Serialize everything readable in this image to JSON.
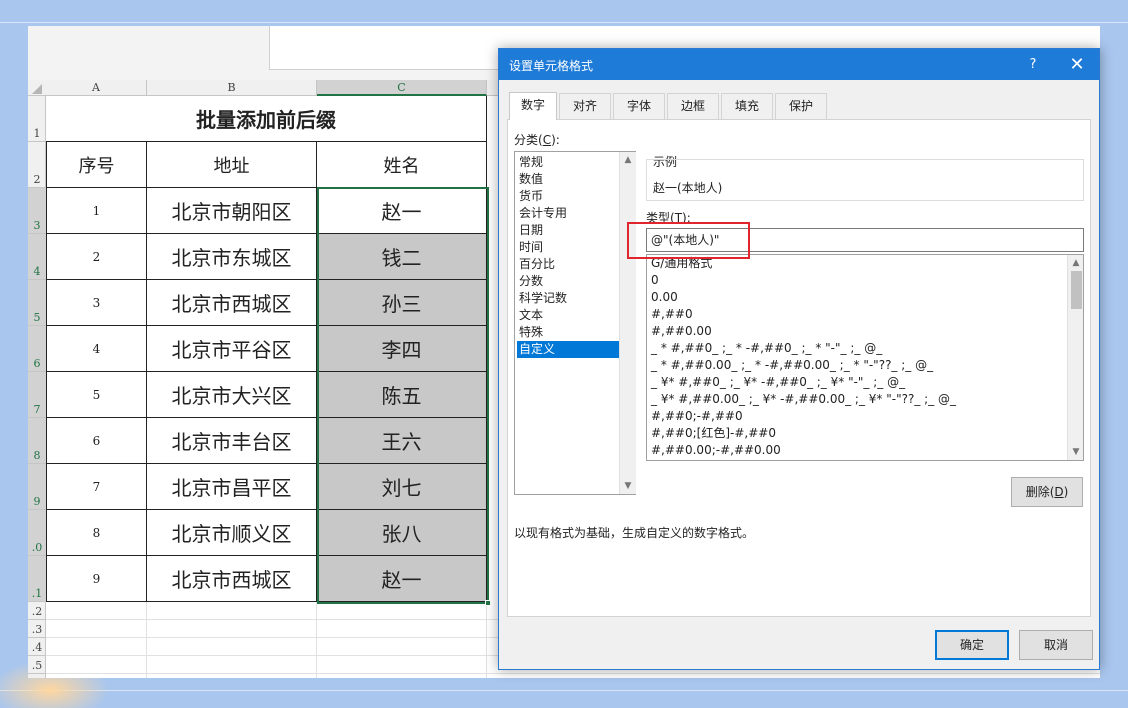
{
  "spreadsheet": {
    "columns": [
      "A",
      "B",
      "C"
    ],
    "row_numbers": [
      "1",
      "2",
      "3",
      "4",
      "5",
      "6",
      "7",
      "8",
      "9",
      ".0",
      ".1",
      ".2",
      ".3",
      ".4",
      ".5"
    ],
    "title": "批量添加前后缀",
    "headers": [
      "序号",
      "地址",
      "姓名"
    ],
    "rows": [
      {
        "idx": "1",
        "addr": "北京市朝阳区",
        "name": "赵一"
      },
      {
        "idx": "2",
        "addr": "北京市东城区",
        "name": "钱二"
      },
      {
        "idx": "3",
        "addr": "北京市西城区",
        "name": "孙三"
      },
      {
        "idx": "4",
        "addr": "北京市平谷区",
        "name": "李四"
      },
      {
        "idx": "5",
        "addr": "北京市大兴区",
        "name": "陈五"
      },
      {
        "idx": "6",
        "addr": "北京市丰台区",
        "name": "王六"
      },
      {
        "idx": "7",
        "addr": "北京市昌平区",
        "name": "刘七"
      },
      {
        "idx": "8",
        "addr": "北京市顺义区",
        "name": "张八"
      },
      {
        "idx": "9",
        "addr": "北京市西城区",
        "name": "赵一"
      }
    ],
    "selected_column": "C",
    "accent_color": "#217346"
  },
  "dialog": {
    "title": "设置单元格格式",
    "help_label": "?",
    "close_label": "✕",
    "tabs": [
      {
        "label": "数字",
        "active": true
      },
      {
        "label": "对齐",
        "active": false
      },
      {
        "label": "字体",
        "active": false
      },
      {
        "label": "边框",
        "active": false
      },
      {
        "label": "填充",
        "active": false
      },
      {
        "label": "保护",
        "active": false
      }
    ],
    "category_label": "分类(",
    "category_key": "C",
    "category_label_end": "):",
    "categories": [
      "常规",
      "数值",
      "货币",
      "会计专用",
      "日期",
      "时间",
      "百分比",
      "分数",
      "科学记数",
      "文本",
      "特殊",
      "自定义"
    ],
    "selected_category": "自定义",
    "sample_label": "示例",
    "sample_value": "赵一(本地人)",
    "type_label": "类型(",
    "type_key": "T",
    "type_label_end": "):",
    "type_value": "@\"(本地人)\"",
    "type_options": [
      "G/通用格式",
      "0",
      "0.00",
      "#,##0",
      "#,##0.00",
      "_ * #,##0_ ;_ * -#,##0_ ;_ * \"-\"_ ;_ @_",
      "_ * #,##0.00_ ;_ * -#,##0.00_ ;_ * \"-\"??_ ;_ @_",
      "_ ¥* #,##0_ ;_ ¥* -#,##0_ ;_ ¥* \"-\"_ ;_ @_",
      "_ ¥* #,##0.00_ ;_ ¥* -#,##0.00_ ;_ ¥* \"-\"??_ ;_ @_",
      "#,##0;-#,##0",
      "#,##0;[红色]-#,##0",
      "#,##0.00;-#,##0.00"
    ],
    "delete_label": "删除(",
    "delete_key": "D",
    "delete_label_end": ")",
    "description": "以现有格式为基础，生成自定义的数字格式。",
    "ok_label": "确定",
    "cancel_label": "取消",
    "title_bar_color": "#1e7bd8",
    "highlight_color": "#e0252c"
  }
}
